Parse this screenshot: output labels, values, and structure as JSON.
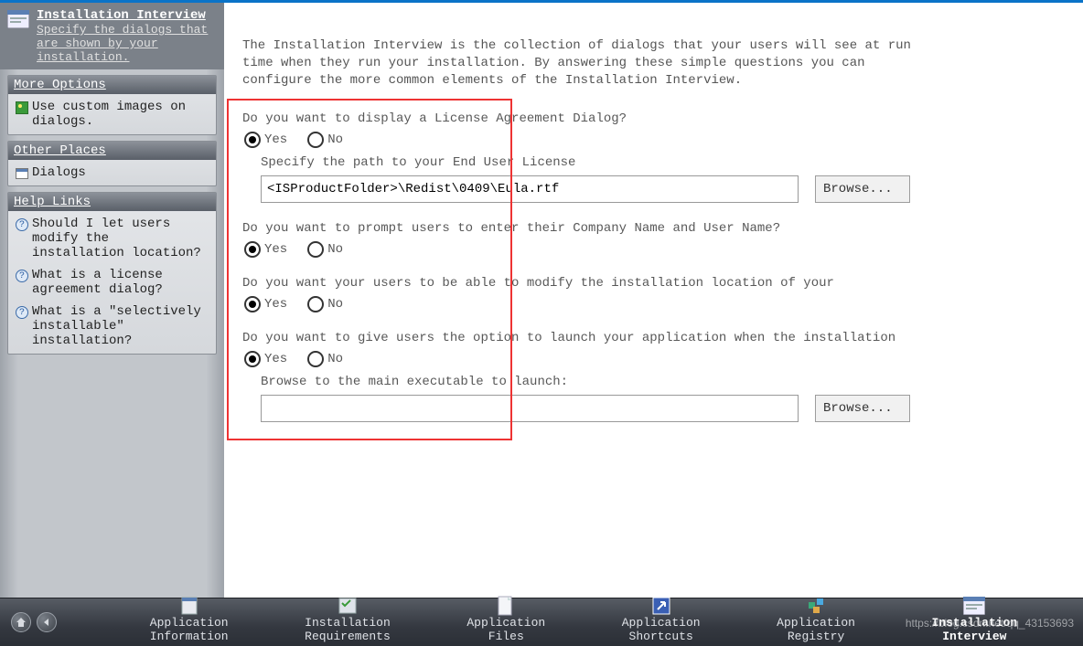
{
  "sidebar": {
    "title": "Installation Interview",
    "subtitle": "Specify the dialogs that are shown by your installation.",
    "panels": {
      "more_options": {
        "title": "More Options",
        "items": [
          "Use custom images on dialogs."
        ]
      },
      "other_places": {
        "title": "Other Places",
        "items": [
          "Dialogs"
        ]
      },
      "help_links": {
        "title": "Help Links",
        "items": [
          "Should I let users modify the installation location?",
          "What is a license agreement dialog?",
          "What is a \"selectively installable\" installation?"
        ]
      }
    }
  },
  "main": {
    "intro": "The Installation Interview is the collection of dialogs that your users will see at run time when they run your installation. By answering these simple questions you can configure the more common elements of the Installation Interview.",
    "q1": {
      "text": "Do you want to display a License Agreement Dialog?",
      "yes": "Yes",
      "no": "No",
      "sublabel": "Specify the path to your End User License",
      "path": "<ISProductFolder>\\Redist\\0409\\Eula.rtf",
      "browse": "Browse..."
    },
    "q2": {
      "text": "Do you want to prompt users to enter their Company Name and User Name?",
      "yes": "Yes",
      "no": "No"
    },
    "q3": {
      "text": "Do you want your users to be able to modify the installation location of your",
      "yes": "Yes",
      "no": "No"
    },
    "q4": {
      "text": "Do you want to give users the option to launch your application when the installation",
      "yes": "Yes",
      "no": "No",
      "sublabel": "Browse to the main executable to launch:",
      "path": "",
      "browse": "Browse..."
    }
  },
  "bottom": {
    "tabs": [
      "Application\nInformation",
      "Installation\nRequirements",
      "Application\nFiles",
      "Application\nShortcuts",
      "Application\nRegistry",
      "Installation\nInterview"
    ]
  },
  "watermark": "https://blog.csdn.net/qq_43153693"
}
